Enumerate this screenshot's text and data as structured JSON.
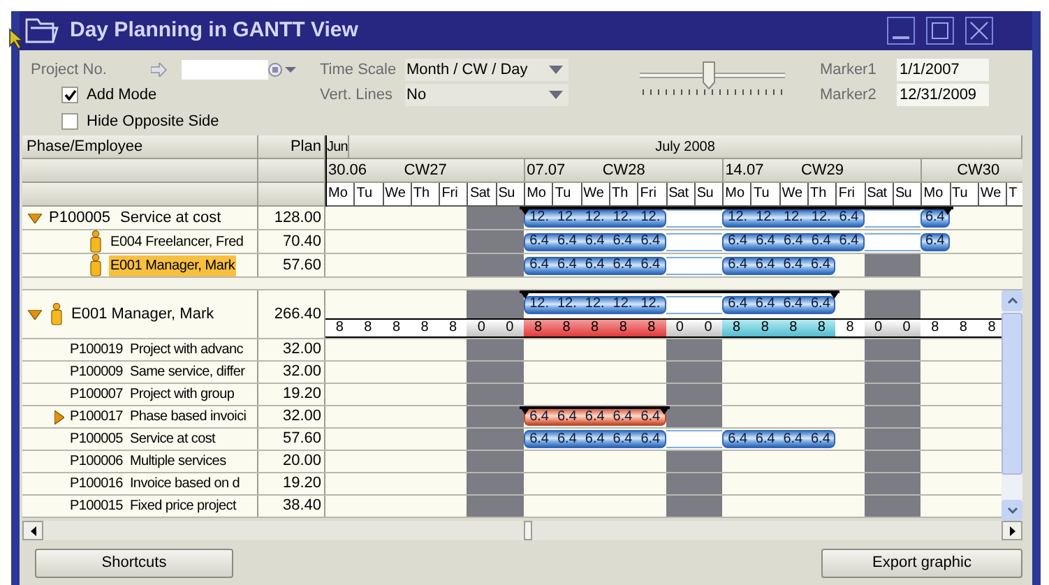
{
  "window": {
    "title": "Day Planning in GANTT View"
  },
  "filters": {
    "project_no": {
      "label": "Project No."
    },
    "add_mode": {
      "label": "Add Mode",
      "checked": true
    },
    "hide_opposite_side": {
      "label": "Hide Opposite Side",
      "checked": false
    },
    "time_scale": {
      "label": "Time Scale",
      "value": "Month / CW / Day"
    },
    "vert_lines": {
      "label": "Vert. Lines",
      "value": "No"
    },
    "zoom_slider": {
      "level": 0.47
    },
    "marker1": {
      "label": "Marker1",
      "value": "1/1/2007"
    },
    "marker2": {
      "label": "Marker2",
      "value": "12/31/2009"
    }
  },
  "grid": {
    "columns": [
      "Phase/Employee",
      "Plan"
    ],
    "months": [
      {
        "label": "Jun"
      },
      {
        "label": "July 2008"
      }
    ],
    "weeks": [
      {
        "date": "30.06",
        "label": "CW27"
      },
      {
        "date": "07.07",
        "label": "CW28"
      },
      {
        "date": "14.07",
        "label": "CW29"
      },
      {
        "label": "CW30"
      }
    ],
    "days": [
      {
        "label": "Mo",
        "weekend": false
      },
      {
        "label": "Tu",
        "weekend": false
      },
      {
        "label": "We",
        "weekend": false
      },
      {
        "label": "Th",
        "weekend": false
      },
      {
        "label": "Fri",
        "weekend": false
      },
      {
        "label": "Sat",
        "weekend": true
      },
      {
        "label": "Su",
        "weekend": true
      },
      {
        "label": "Mo",
        "weekend": false
      },
      {
        "label": "Tu",
        "weekend": false
      },
      {
        "label": "We",
        "weekend": false
      },
      {
        "label": "Th",
        "weekend": false
      },
      {
        "label": "Fri",
        "weekend": false
      },
      {
        "label": "Sat",
        "weekend": true
      },
      {
        "label": "Su",
        "weekend": true
      },
      {
        "label": "Mo",
        "weekend": false
      },
      {
        "label": "Tu",
        "weekend": false
      },
      {
        "label": "We",
        "weekend": false
      },
      {
        "label": "Th",
        "weekend": false
      },
      {
        "label": "Fri",
        "weekend": false
      },
      {
        "label": "Sat",
        "weekend": true
      },
      {
        "label": "Su",
        "weekend": true
      },
      {
        "label": "Mo",
        "weekend": false
      },
      {
        "label": "Tu",
        "weekend": false
      },
      {
        "label": "We",
        "weekend": false
      },
      {
        "label": "T",
        "weekend": false
      }
    ],
    "phase_rows": [
      {
        "kind": "phase",
        "id": "P100005",
        "name": "Service at cost",
        "plan": "128.00",
        "expanded": true,
        "bar": {
          "kind": "planned",
          "summary": true,
          "cells": [
            {
              "kind": "empty"
            },
            {
              "kind": "empty"
            },
            {
              "kind": "empty"
            },
            {
              "kind": "empty"
            },
            {
              "kind": "empty"
            },
            {
              "kind": "empty"
            },
            {
              "kind": "empty"
            },
            {
              "kind": "value",
              "text": "12."
            },
            {
              "kind": "value",
              "text": "12."
            },
            {
              "kind": "value",
              "text": "12."
            },
            {
              "kind": "value",
              "text": "12."
            },
            {
              "kind": "value",
              "text": "12."
            },
            {
              "kind": "gap"
            },
            {
              "kind": "gap"
            },
            {
              "kind": "value",
              "text": "12."
            },
            {
              "kind": "value",
              "text": "12."
            },
            {
              "kind": "value",
              "text": "12."
            },
            {
              "kind": "value",
              "text": "12."
            },
            {
              "kind": "value",
              "text": "6.4"
            },
            {
              "kind": "gap"
            },
            {
              "kind": "gap"
            },
            {
              "kind": "value",
              "text": "6.4"
            }
          ]
        }
      },
      {
        "kind": "employee",
        "label": "E004 Freelancer, Fred",
        "plan": "70.40",
        "selected": false,
        "bar": {
          "kind": "planned",
          "summary": false,
          "cells": [
            {
              "kind": "empty"
            },
            {
              "kind": "empty"
            },
            {
              "kind": "empty"
            },
            {
              "kind": "empty"
            },
            {
              "kind": "empty"
            },
            {
              "kind": "empty"
            },
            {
              "kind": "empty"
            },
            {
              "kind": "value",
              "text": "6.4"
            },
            {
              "kind": "value",
              "text": "6.4"
            },
            {
              "kind": "value",
              "text": "6.4"
            },
            {
              "kind": "value",
              "text": "6.4"
            },
            {
              "kind": "value",
              "text": "6.4"
            },
            {
              "kind": "gap"
            },
            {
              "kind": "gap"
            },
            {
              "kind": "value",
              "text": "6.4"
            },
            {
              "kind": "value",
              "text": "6.4"
            },
            {
              "kind": "value",
              "text": "6.4"
            },
            {
              "kind": "value",
              "text": "6.4"
            },
            {
              "kind": "value",
              "text": "6.4"
            },
            {
              "kind": "gap"
            },
            {
              "kind": "gap"
            },
            {
              "kind": "value",
              "text": "6.4"
            }
          ]
        }
      },
      {
        "kind": "employee",
        "label": "E001 Manager, Mark",
        "plan": "57.60",
        "selected": true,
        "bar": {
          "kind": "planned",
          "summary": false,
          "cells": [
            {
              "kind": "empty"
            },
            {
              "kind": "empty"
            },
            {
              "kind": "empty"
            },
            {
              "kind": "empty"
            },
            {
              "kind": "empty"
            },
            {
              "kind": "empty"
            },
            {
              "kind": "empty"
            },
            {
              "kind": "value",
              "text": "6.4"
            },
            {
              "kind": "value",
              "text": "6.4"
            },
            {
              "kind": "value",
              "text": "6.4"
            },
            {
              "kind": "value",
              "text": "6.4"
            },
            {
              "kind": "value",
              "text": "6.4"
            },
            {
              "kind": "gap"
            },
            {
              "kind": "gap"
            },
            {
              "kind": "value",
              "text": "6.4"
            },
            {
              "kind": "value",
              "text": "6.4"
            },
            {
              "kind": "value",
              "text": "6.4"
            },
            {
              "kind": "value",
              "text": "6.4"
            }
          ]
        }
      }
    ],
    "employee_block": {
      "label": "E001 Manager, Mark",
      "plan": "266.40",
      "expanded": true,
      "bar": {
        "kind": "planned",
        "summary": true,
        "cells": [
          {
            "kind": "empty"
          },
          {
            "kind": "empty"
          },
          {
            "kind": "empty"
          },
          {
            "kind": "empty"
          },
          {
            "kind": "empty"
          },
          {
            "kind": "empty"
          },
          {
            "kind": "empty"
          },
          {
            "kind": "value",
            "text": "12."
          },
          {
            "kind": "value",
            "text": "12."
          },
          {
            "kind": "value",
            "text": "12."
          },
          {
            "kind": "value",
            "text": "12."
          },
          {
            "kind": "value",
            "text": "12."
          },
          {
            "kind": "gap"
          },
          {
            "kind": "gap"
          },
          {
            "kind": "value",
            "text": "6.4"
          },
          {
            "kind": "value",
            "text": "6.4"
          },
          {
            "kind": "value",
            "text": "6.4"
          },
          {
            "kind": "value",
            "text": "6.4"
          }
        ]
      },
      "hours": [
        {
          "text": "8",
          "kind": "plain"
        },
        {
          "text": "8",
          "kind": "plain"
        },
        {
          "text": "8",
          "kind": "plain"
        },
        {
          "text": "8",
          "kind": "plain"
        },
        {
          "text": "8",
          "kind": "plain"
        },
        {
          "text": "0",
          "kind": "off"
        },
        {
          "text": "0",
          "kind": "off"
        },
        {
          "text": "8",
          "kind": "over"
        },
        {
          "text": "8",
          "kind": "over"
        },
        {
          "text": "8",
          "kind": "over"
        },
        {
          "text": "8",
          "kind": "over"
        },
        {
          "text": "8",
          "kind": "over"
        },
        {
          "text": "0",
          "kind": "off"
        },
        {
          "text": "0",
          "kind": "off"
        },
        {
          "text": "8",
          "kind": "partial"
        },
        {
          "text": "8",
          "kind": "partial"
        },
        {
          "text": "8",
          "kind": "partial"
        },
        {
          "text": "8",
          "kind": "partial"
        },
        {
          "text": "8",
          "kind": "plain"
        },
        {
          "text": "0",
          "kind": "off"
        },
        {
          "text": "0",
          "kind": "off"
        },
        {
          "text": "8",
          "kind": "plain"
        },
        {
          "text": "8",
          "kind": "plain"
        },
        {
          "text": "8",
          "kind": "plain"
        }
      ],
      "projects": [
        {
          "id": "P100019",
          "name": "Project with advanc",
          "plan": "32.00"
        },
        {
          "id": "P100009",
          "name": "Same service, differ",
          "plan": "32.00"
        },
        {
          "id": "P100007",
          "name": "Project with group",
          "plan": "19.20"
        },
        {
          "id": "P100017",
          "name": "Phase based invoici",
          "plan": "32.00",
          "expanded": false,
          "bar": {
            "kind": "pending",
            "summary": true,
            "cells": [
              {
                "kind": "empty"
              },
              {
                "kind": "empty"
              },
              {
                "kind": "empty"
              },
              {
                "kind": "empty"
              },
              {
                "kind": "empty"
              },
              {
                "kind": "empty"
              },
              {
                "kind": "empty"
              },
              {
                "kind": "value",
                "text": "6.4"
              },
              {
                "kind": "value",
                "text": "6.4"
              },
              {
                "kind": "value",
                "text": "6.4"
              },
              {
                "kind": "value",
                "text": "6.4"
              },
              {
                "kind": "value",
                "text": "6.4"
              }
            ]
          }
        },
        {
          "id": "P100005",
          "name": "Service at cost",
          "plan": "57.60",
          "bar": {
            "kind": "planned",
            "summary": false,
            "cells": [
              {
                "kind": "empty"
              },
              {
                "kind": "empty"
              },
              {
                "kind": "empty"
              },
              {
                "kind": "empty"
              },
              {
                "kind": "empty"
              },
              {
                "kind": "empty"
              },
              {
                "kind": "empty"
              },
              {
                "kind": "value",
                "text": "6.4"
              },
              {
                "kind": "value",
                "text": "6.4"
              },
              {
                "kind": "value",
                "text": "6.4"
              },
              {
                "kind": "value",
                "text": "6.4"
              },
              {
                "kind": "value",
                "text": "6.4"
              },
              {
                "kind": "gap"
              },
              {
                "kind": "gap"
              },
              {
                "kind": "value",
                "text": "6.4"
              },
              {
                "kind": "value",
                "text": "6.4"
              },
              {
                "kind": "value",
                "text": "6.4"
              },
              {
                "kind": "value",
                "text": "6.4"
              }
            ]
          }
        },
        {
          "id": "P100006",
          "name": "Multiple services",
          "plan": "20.00"
        },
        {
          "id": "P100016",
          "name": "Invoice based on d",
          "plan": "19.20"
        },
        {
          "id": "P100015",
          "name": "Fixed price project",
          "plan": "38.40"
        }
      ]
    }
  },
  "buttons": [
    "Shortcuts",
    "Export graphic"
  ]
}
